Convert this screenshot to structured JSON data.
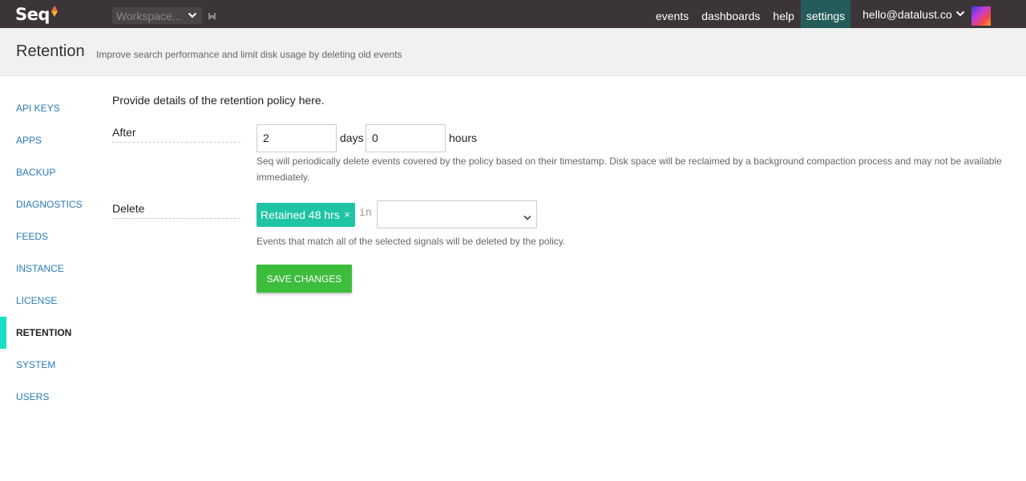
{
  "brand": {
    "name": "Seq"
  },
  "workspace": {
    "label": "Workspace..."
  },
  "nav": {
    "items": [
      {
        "label": "events"
      },
      {
        "label": "dashboards"
      },
      {
        "label": "help"
      },
      {
        "label": "settings",
        "active": true
      }
    ],
    "user": {
      "email": "hello@datalust.co"
    }
  },
  "page": {
    "title": "Retention",
    "subtitle": "Improve search performance and limit disk usage by deleting old events"
  },
  "sidebar": {
    "items": [
      {
        "label": "API KEYS"
      },
      {
        "label": "APPS"
      },
      {
        "label": "BACKUP"
      },
      {
        "label": "DIAGNOSTICS"
      },
      {
        "label": "FEEDS"
      },
      {
        "label": "INSTANCE"
      },
      {
        "label": "LICENSE"
      },
      {
        "label": "RETENTION",
        "active": true
      },
      {
        "label": "SYSTEM"
      },
      {
        "label": "USERS"
      }
    ]
  },
  "form": {
    "intro": "Provide details of the retention policy here.",
    "after": {
      "label": "After",
      "days_value": "2",
      "days_unit": "days",
      "hours_value": "0",
      "hours_unit": "hours",
      "help": "Seq will periodically delete events covered by the policy based on their timestamp. Disk space will be reclaimed by a background compaction process and may not be available immediately."
    },
    "delete": {
      "label": "Delete",
      "signal_chip": "Retained 48 hrs",
      "remove_symbol": "×",
      "in_text": "in",
      "select_value": "",
      "help": "Events that match all of the selected signals will be deleted by the policy."
    },
    "save_label": "SAVE CHANGES"
  },
  "colors": {
    "topbar": "#3b3538",
    "nav_active": "#245c5b",
    "link": "#2a7ab8",
    "active_marker": "#18e0c8",
    "chip": "#1ec4a4",
    "save": "#3cbd3c"
  }
}
